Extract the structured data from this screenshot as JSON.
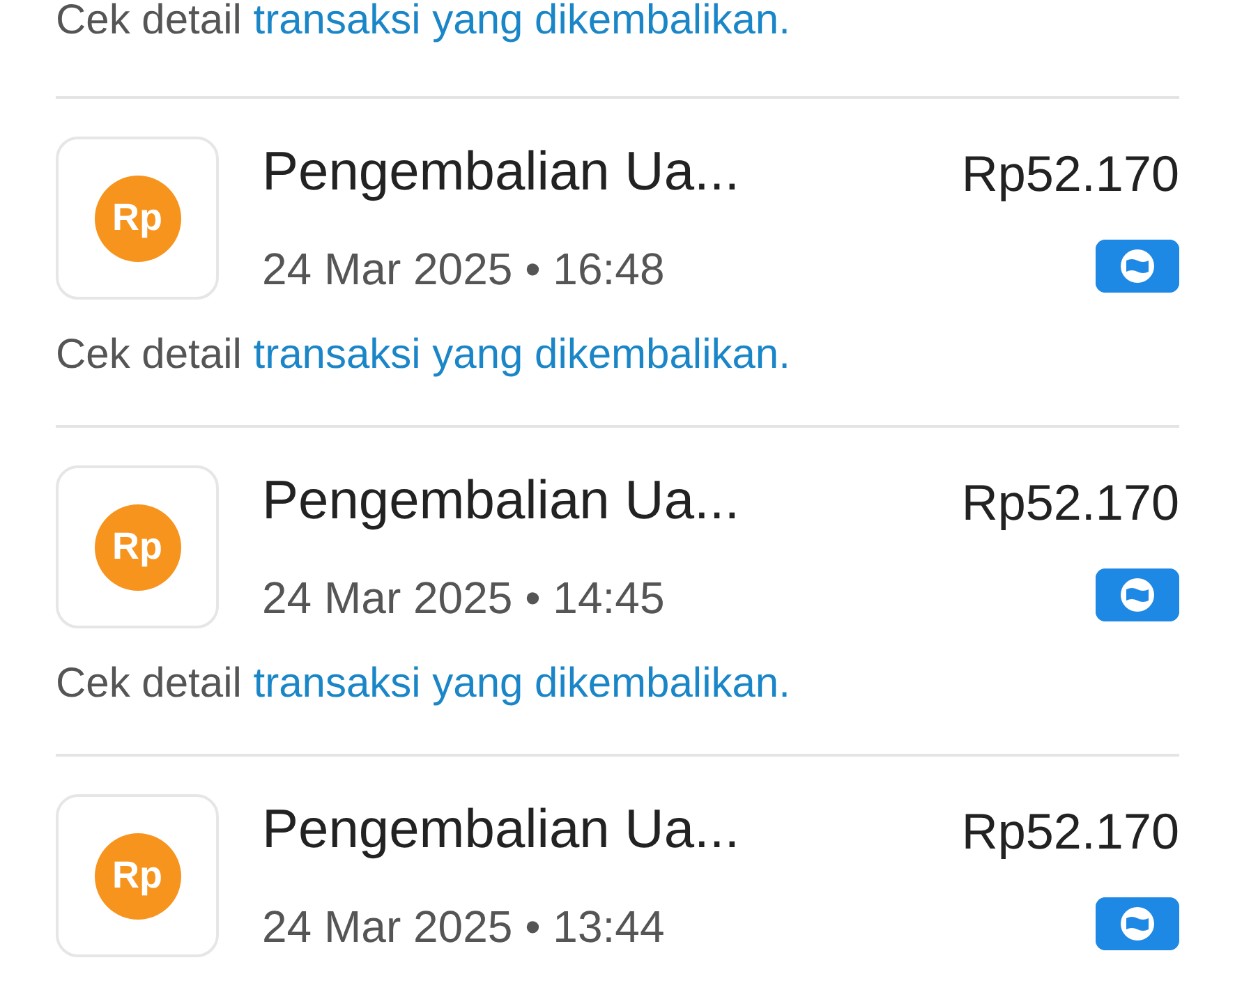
{
  "top_note": {
    "text": "Cek detail ",
    "link": "transaksi yang dikembalikan."
  },
  "transactions": [
    {
      "icon_text": "Rp",
      "title": "Pengembalian Ua...",
      "amount": "Rp52.170",
      "date": "24 Mar 2025",
      "separator": "•",
      "time": "16:48",
      "note": "Cek detail ",
      "link": "transaksi yang dikembalikan."
    },
    {
      "icon_text": "Rp",
      "title": "Pengembalian Ua...",
      "amount": "Rp52.170",
      "date": "24 Mar 2025",
      "separator": "•",
      "time": "14:45",
      "note": "Cek detail ",
      "link": "transaksi yang dikembalikan."
    },
    {
      "icon_text": "Rp",
      "title": "Pengembalian Ua...",
      "amount": "Rp52.170",
      "date": "24 Mar 2025",
      "separator": "•",
      "time": "13:44"
    }
  ]
}
